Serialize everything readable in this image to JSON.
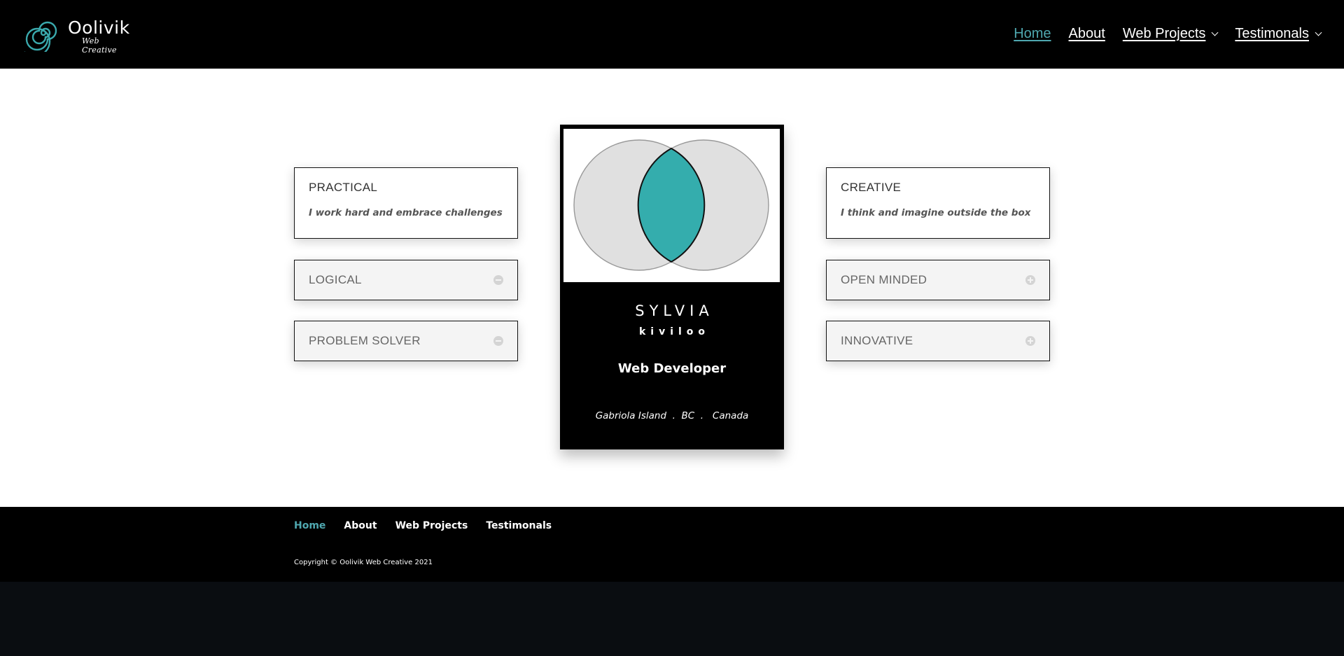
{
  "brand": {
    "title": "Oolivik",
    "subtitle": "Web Creative",
    "accent_color": "#3aa9ad"
  },
  "nav": {
    "items": [
      {
        "label": "Home",
        "active": true
      },
      {
        "label": "About"
      },
      {
        "label": "Web Projects",
        "has_dropdown": true
      },
      {
        "label": "Testimonals",
        "has_dropdown": true
      }
    ]
  },
  "left": {
    "info": {
      "title": "PRACTICAL",
      "text": "I work hard and embrace challenges"
    },
    "toggles": [
      {
        "title": "LOGICAL",
        "icon": "minus-circle-icon"
      },
      {
        "title": "PROBLEM SOLVER",
        "icon": "minus-circle-icon"
      }
    ]
  },
  "right": {
    "info": {
      "title": "CREATIVE",
      "text": "I think and imagine outside the box"
    },
    "toggles": [
      {
        "title": "OPEN MINDED",
        "icon": "plus-circle-icon"
      },
      {
        "title": "INNOVATIVE",
        "icon": "plus-circle-icon"
      }
    ]
  },
  "card": {
    "name": "SYLVIA",
    "surname": "kiviloo",
    "role": "Web Developer",
    "location": "Gabriola Island  .  BC  .   Canada",
    "venn_overlap_color": "#34adad",
    "venn_circle_color": "#e0e0e0"
  },
  "footer": {
    "links": [
      {
        "label": "Home",
        "active": true
      },
      {
        "label": "About"
      },
      {
        "label": "Web Projects"
      },
      {
        "label": "Testimonals"
      }
    ],
    "copyright": "Copyright © Oolivik Web Creative 2021"
  }
}
